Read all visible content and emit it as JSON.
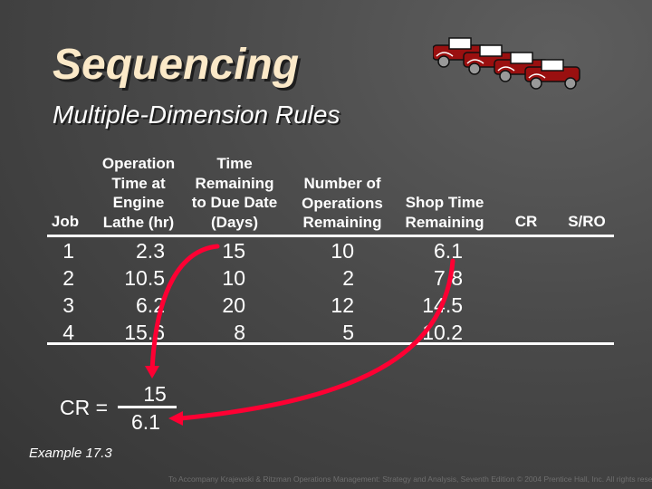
{
  "title": "Sequencing",
  "subtitle": "Multiple-Dimension Rules",
  "table": {
    "headers": [
      {
        "key": "job",
        "label": "Job"
      },
      {
        "key": "op_time",
        "label": "Operation\nTime at\nEngine\nLathe (hr)"
      },
      {
        "key": "time_remaining",
        "label": "Time\nRemaining\nto Due Date\n(Days)"
      },
      {
        "key": "ops_remaining",
        "label": "Number of\nOperations\nRemaining"
      },
      {
        "key": "shop_time",
        "label": "Shop Time\nRemaining"
      },
      {
        "key": "cr",
        "label": "CR"
      },
      {
        "key": "sro",
        "label": "S/RO"
      }
    ],
    "rows": [
      {
        "job": "1",
        "op_time": "2.3",
        "time_remaining": "15",
        "ops_remaining": "10",
        "shop_time": "6.1",
        "cr": "",
        "sro": ""
      },
      {
        "job": "2",
        "op_time": "10.5",
        "time_remaining": "10",
        "ops_remaining": "2",
        "shop_time": "7.8",
        "cr": "",
        "sro": ""
      },
      {
        "job": "3",
        "op_time": "6.2",
        "time_remaining": "20",
        "ops_remaining": "12",
        "shop_time": "14.5",
        "cr": "",
        "sro": ""
      },
      {
        "job": "4",
        "op_time": "15.6",
        "time_remaining": "8",
        "ops_remaining": "5",
        "shop_time": "10.2",
        "cr": "",
        "sro": ""
      }
    ]
  },
  "formula": {
    "label": "CR =",
    "numerator": "15",
    "denominator": "6.1"
  },
  "example_label": "Example 17.3",
  "footer": "To Accompany Krajewski & Ritzman Operations Management: Strategy and Analysis, Seventh Edition © 2004 Prentice Hall, Inc. All rights reserved.",
  "icons": {
    "cars": "vintage-cars-clipart",
    "arrows": "red-curved-arrows"
  },
  "colors": {
    "title": "#fbe9c8",
    "arrow": "#ff0033",
    "car_body": "#9a1010"
  }
}
